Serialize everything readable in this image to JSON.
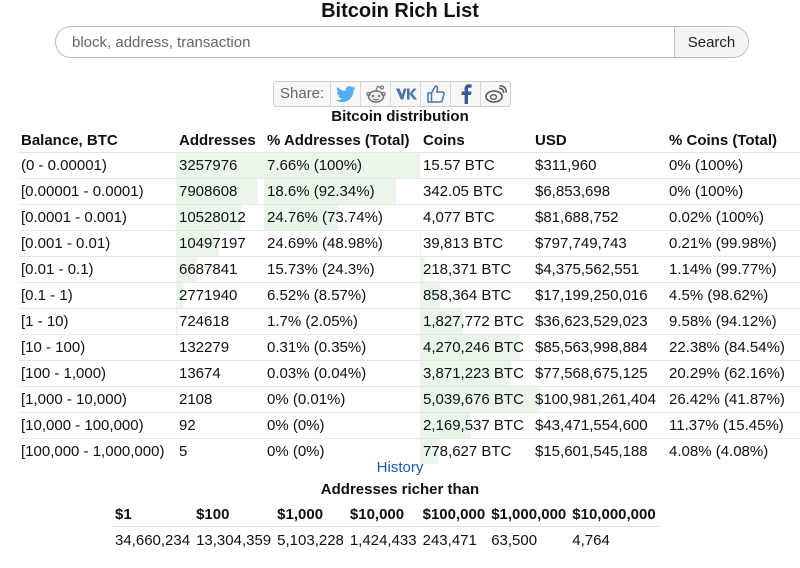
{
  "page_title": "Bitcoin Rich List",
  "search": {
    "placeholder": "block, address, transaction",
    "button_label": "Search"
  },
  "share": {
    "label": "Share:",
    "buttons": [
      {
        "icon": "twitter-icon",
        "color": "#55acee"
      },
      {
        "icon": "reddit-icon",
        "color": "#777777"
      },
      {
        "icon": "vk-icon",
        "color": "#4a76a8"
      },
      {
        "icon": "like-icon",
        "color": "#4a76a8"
      },
      {
        "icon": "facebook-icon",
        "color": "#3b5998"
      },
      {
        "icon": "weibo-icon",
        "color": "#555555"
      }
    ]
  },
  "distribution": {
    "title": "Bitcoin distribution",
    "headers": [
      "Balance, BTC",
      "Addresses",
      "% Addresses (Total)",
      "Coins",
      "USD",
      "% Coins (Total)"
    ],
    "highlight_color": "#eaf6ea",
    "rows": [
      {
        "cells": [
          "(0 - 0.00001)",
          "3257976",
          "7.66% (100%)",
          "15.57 BTC",
          "$311,960",
          "0% (100%)"
        ],
        "addr_pct": 100,
        "coins_pct": 0
      },
      {
        "cells": [
          "[0.00001 - 0.0001)",
          "7908608",
          "18.6% (92.34%)",
          "342.05 BTC",
          "$6,853,698",
          "0% (100%)"
        ],
        "addr_pct": 92.34,
        "coins_pct": 0
      },
      {
        "cells": [
          "[0.0001 - 0.001)",
          "10528012",
          "24.76% (73.74%)",
          "4,077 BTC",
          "$81,688,752",
          "0.02% (100%)"
        ],
        "addr_pct": 73.74,
        "coins_pct": 0.02
      },
      {
        "cells": [
          "[0.001 - 0.01)",
          "10497197",
          "24.69% (48.98%)",
          "39,813 BTC",
          "$797,749,743",
          "0.21% (99.98%)"
        ],
        "addr_pct": 48.98,
        "coins_pct": 0.21
      },
      {
        "cells": [
          "[0.01 - 0.1)",
          "6687841",
          "15.73% (24.3%)",
          "218,371 BTC",
          "$4,375,562,551",
          "1.14% (99.77%)"
        ],
        "addr_pct": 24.3,
        "coins_pct": 1.14
      },
      {
        "cells": [
          "[0.1 - 1)",
          "2771940",
          "6.52% (8.57%)",
          "858,364 BTC",
          "$17,199,250,016",
          "4.5% (98.62%)"
        ],
        "addr_pct": 8.57,
        "coins_pct": 4.5
      },
      {
        "cells": [
          "[1 - 10)",
          "724618",
          "1.7% (2.05%)",
          "1,827,772 BTC",
          "$36,623,529,023",
          "9.58% (94.12%)"
        ],
        "addr_pct": 2.05,
        "coins_pct": 9.58
      },
      {
        "cells": [
          "[10 - 100)",
          "132279",
          "0.31% (0.35%)",
          "4,270,246 BTC",
          "$85,563,998,884",
          "22.38% (84.54%)"
        ],
        "addr_pct": 0.35,
        "coins_pct": 22.38
      },
      {
        "cells": [
          "[100 - 1,000)",
          "13674",
          "0.03% (0.04%)",
          "3,871,223 BTC",
          "$77,568,675,125",
          "20.29% (62.16%)"
        ],
        "addr_pct": 0.04,
        "coins_pct": 20.29
      },
      {
        "cells": [
          "[1,000 - 10,000)",
          "2108",
          "0% (0.01%)",
          "5,039,676 BTC",
          "$100,981,261,404",
          "26.42% (41.87%)"
        ],
        "addr_pct": 0.01,
        "coins_pct": 26.42
      },
      {
        "cells": [
          "[10,000 - 100,000)",
          "92",
          "0% (0%)",
          "2,169,537 BTC",
          "$43,471,554,600",
          "11.37% (15.45%)"
        ],
        "addr_pct": 0,
        "coins_pct": 11.37
      },
      {
        "cells": [
          "[100,000 - 1,000,000)",
          "5",
          "0% (0%)",
          "778,627 BTC",
          "$15,601,545,188",
          "4.08% (4.08%)"
        ],
        "addr_pct": 0,
        "coins_pct": 4.08
      }
    ]
  },
  "history_link": "History",
  "richer": {
    "title": "Addresses richer than",
    "headers": [
      "$1",
      "$100",
      "$1,000",
      "$10,000",
      "$100,000",
      "$1,000,000",
      "$10,000,000"
    ],
    "values": [
      "34,660,234",
      "13,304,359",
      "5,103,228",
      "1,424,433",
      "243,471",
      "63,500",
      "4,764"
    ]
  }
}
